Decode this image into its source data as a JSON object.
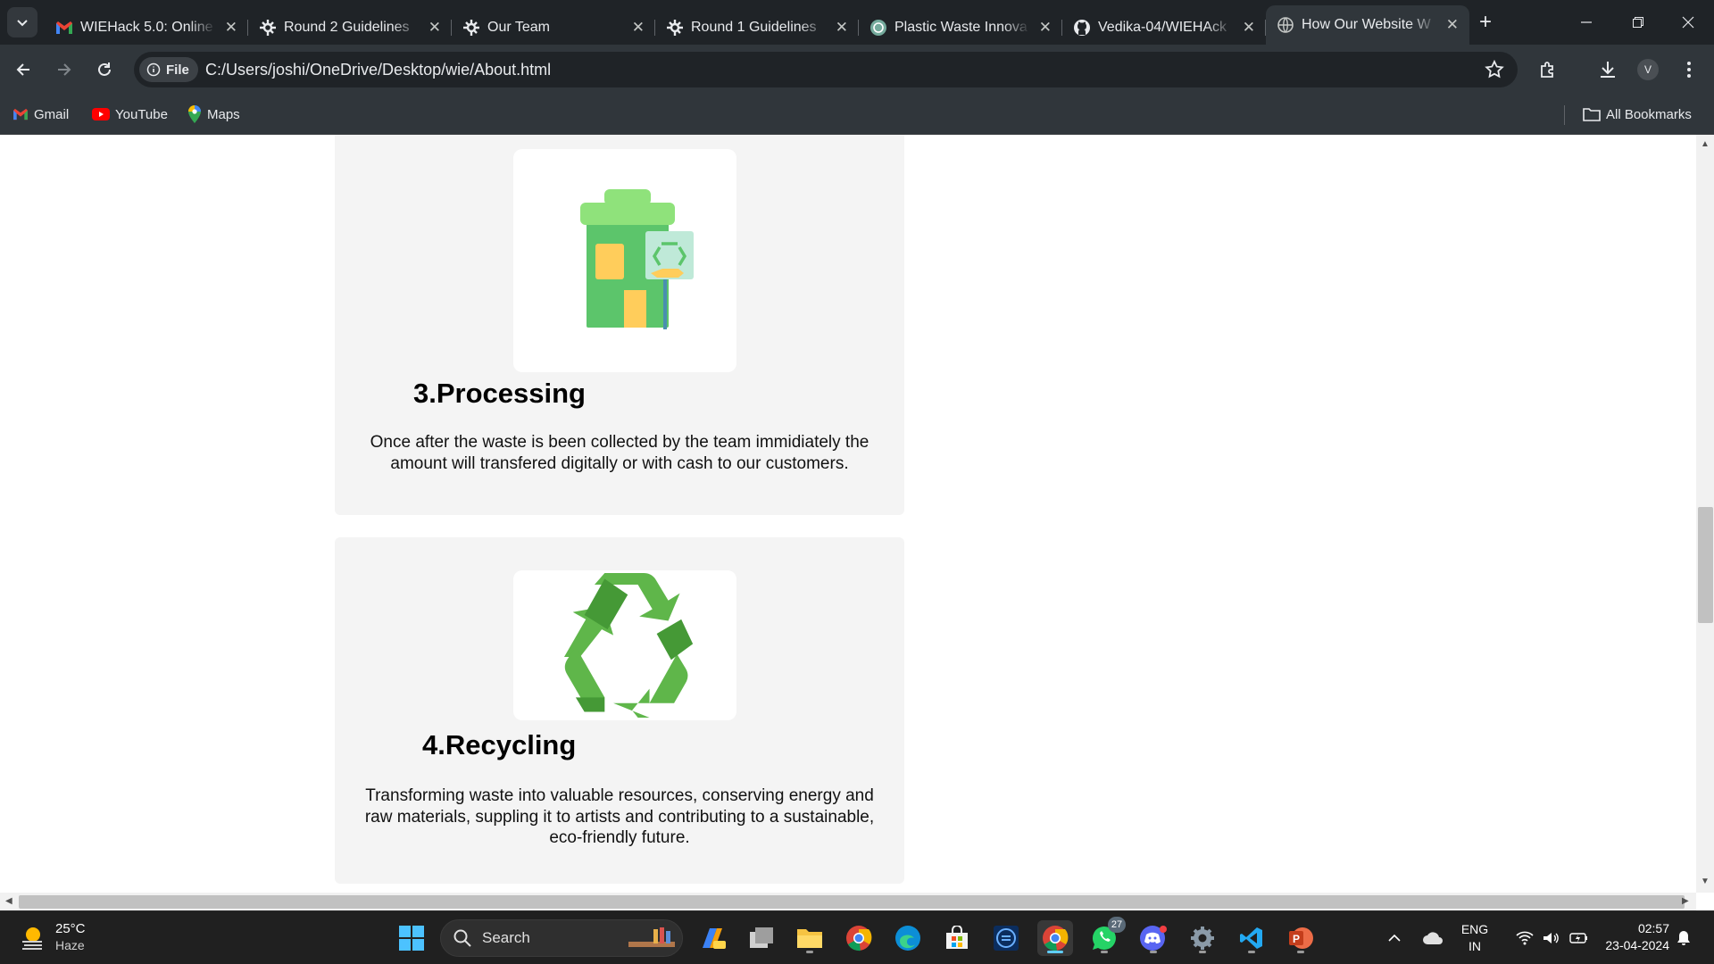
{
  "browser": {
    "tabs": [
      {
        "title": "WIEHack 5.0: Online",
        "icon": "gmail-icon",
        "active": false
      },
      {
        "title": "Round 2 Guidelines",
        "icon": "unstop-icon",
        "active": false
      },
      {
        "title": "Our Team",
        "icon": "unstop-icon",
        "active": false
      },
      {
        "title": "Round 1 Guidelines",
        "icon": "unstop-icon",
        "active": false
      },
      {
        "title": "Plastic Waste Innova",
        "icon": "chatgpt-icon",
        "active": false
      },
      {
        "title": "Vedika-04/WIEHAck",
        "icon": "github-icon",
        "active": false
      },
      {
        "title": "How Our Website W",
        "icon": "globe-icon",
        "active": true
      }
    ],
    "address": {
      "chip": "File",
      "url": "C:/Users/joshi/OneDrive/Desktop/wie/About.html"
    },
    "profile_initial": "V",
    "bookmarks": [
      {
        "label": "Gmail",
        "icon": "gmail-icon"
      },
      {
        "label": "YouTube",
        "icon": "youtube-icon"
      },
      {
        "label": "Maps",
        "icon": "maps-icon"
      }
    ],
    "all_bookmarks": "All Bookmarks"
  },
  "page": {
    "steps": [
      {
        "title": "3.Processing",
        "description": "Once after the waste is been collected by the team immidiately the amount will transfered digitally or with cash to our customers.",
        "icon": "recycle-bin-icon"
      },
      {
        "title": "4.Recycling",
        "description": "Transforming waste into valuable resources, conserving energy and raw materials, suppling it to artists and contributing to a sustainable, eco-friendly future.",
        "icon": "recycle-icon"
      }
    ]
  },
  "taskbar": {
    "weather": {
      "temp": "25°C",
      "condition": "Haze"
    },
    "search_placeholder": "Search",
    "whatsapp_badge": "27",
    "language": {
      "line1": "ENG",
      "line2": "IN"
    },
    "clock": {
      "time": "02:57",
      "date": "23-04-2024"
    }
  },
  "colors": {
    "tab_strip": "#1f2327",
    "toolbar": "#30363b",
    "card_bg": "#f4f4f4",
    "icon_green": "#5cc56b",
    "accent_blue": "#60cdff"
  }
}
